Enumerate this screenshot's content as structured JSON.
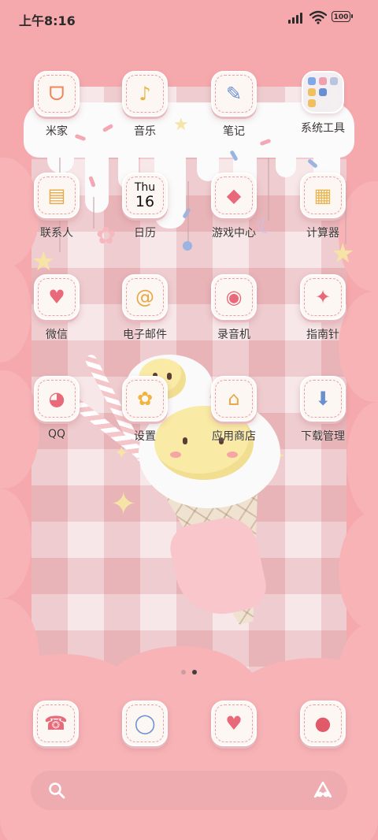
{
  "status_bar": {
    "time": "上午8:16",
    "battery": "100"
  },
  "apps": [
    {
      "label": "米家",
      "icon": "mijia-icon",
      "glyph": "ᗜ",
      "color": "#f0875a"
    },
    {
      "label": "音乐",
      "icon": "music-note-icon",
      "glyph": "♪",
      "color": "#e8b640"
    },
    {
      "label": "笔记",
      "icon": "pen-note-icon",
      "glyph": "✎",
      "color": "#6a8fd0"
    },
    {
      "label": "系统工具",
      "icon": "folder-icon",
      "glyph": "",
      "color": "#7fa8e6"
    },
    {
      "label": "联系人",
      "icon": "contacts-book-icon",
      "glyph": "▤",
      "color": "#e8a845"
    },
    {
      "label": "日历",
      "icon": "calendar-icon",
      "glyph": "",
      "color": "#111111"
    },
    {
      "label": "游戏中心",
      "icon": "game-cube-icon",
      "glyph": "◆",
      "color": "#e86a7a"
    },
    {
      "label": "计算器",
      "icon": "calculator-icon",
      "glyph": "▦",
      "color": "#e8b650"
    },
    {
      "label": "微信",
      "icon": "chat-bubble-icon",
      "glyph": "♥",
      "color": "#e86a7a"
    },
    {
      "label": "电子邮件",
      "icon": "at-mail-icon",
      "glyph": "@",
      "color": "#e8a845"
    },
    {
      "label": "录音机",
      "icon": "cassette-recorder-icon",
      "glyph": "◉",
      "color": "#e86a7a"
    },
    {
      "label": "指南针",
      "icon": "compass-icon",
      "glyph": "✦",
      "color": "#e86a7a"
    },
    {
      "label": "QQ",
      "icon": "penguin-icon",
      "glyph": "◕",
      "color": "#e86a7a"
    },
    {
      "label": "设置",
      "icon": "flower-gear-icon",
      "glyph": "✿",
      "color": "#f0b440"
    },
    {
      "label": "应用商店",
      "icon": "house-store-icon",
      "glyph": "⌂",
      "color": "#e8a845"
    },
    {
      "label": "下载管理",
      "icon": "download-arrow-icon",
      "glyph": "⬇",
      "color": "#6a8fd0"
    }
  ],
  "calendar": {
    "day": "Thu",
    "date": "16"
  },
  "dock": [
    {
      "icon": "phone-icon",
      "glyph": "☎",
      "color": "#e86a7a"
    },
    {
      "icon": "browser-ring-icon",
      "glyph": "◯",
      "color": "#6a8fd0"
    },
    {
      "icon": "messages-heart-icon",
      "glyph": "♥",
      "color": "#e86a7a"
    },
    {
      "icon": "camera-icon",
      "glyph": "●",
      "color": "#e05a6a"
    }
  ],
  "page_indicator": {
    "pages": 2,
    "current": 2
  }
}
